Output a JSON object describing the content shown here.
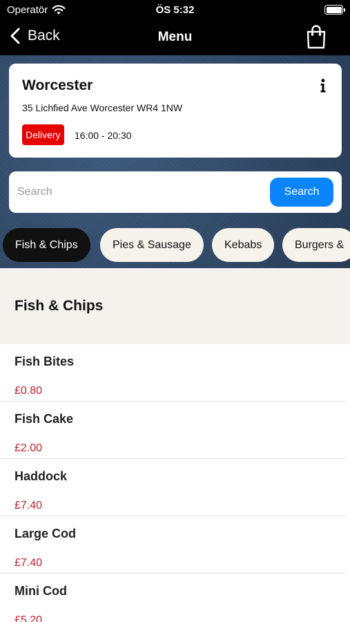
{
  "status_bar": {
    "carrier": "Operatör",
    "time": "ÖS 5:32"
  },
  "nav": {
    "back_label": "Back",
    "title": "Menu"
  },
  "shop": {
    "name": "Worcester",
    "address": "35 Lichfied Ave Worcester WR4 1NW",
    "badge": "Delivery",
    "hours": "16:00 - 20:30"
  },
  "search": {
    "placeholder": "Search",
    "value": "",
    "button_label": "Search"
  },
  "categories": [
    {
      "label": "Fish & Chips",
      "active": true
    },
    {
      "label": "Pies & Sausage",
      "active": false
    },
    {
      "label": "Kebabs",
      "active": false
    },
    {
      "label": "Burgers &",
      "active": false
    }
  ],
  "section": {
    "title": "Fish & Chips"
  },
  "items": [
    {
      "name": "Fish Bites",
      "price": "£0.80"
    },
    {
      "name": "Fish Cake",
      "price": "£2.00"
    },
    {
      "name": "Haddock",
      "price": "£7.40"
    },
    {
      "name": "Large Cod",
      "price": "£7.40"
    },
    {
      "name": "Mini Cod",
      "price": "£5.20"
    }
  ],
  "colors": {
    "accent": "#0a84ff",
    "badge": "#e60000",
    "price": "#c0202c"
  },
  "icons": [
    "wifi-icon",
    "battery-icon",
    "chevron-left-icon",
    "shopping-bag-icon",
    "info-icon"
  ]
}
